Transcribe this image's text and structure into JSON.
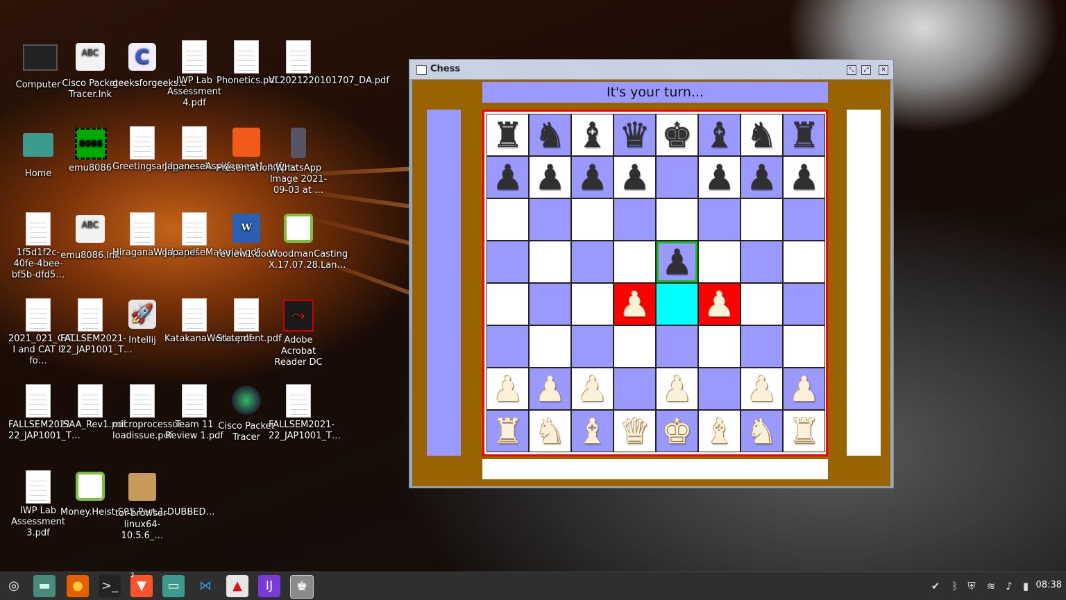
{
  "desktop_icons": [
    {
      "label": "Computer",
      "icon": "monitor-icon"
    },
    {
      "label": "Cisco Packet Tracer.lnk",
      "icon": "text-file-icon"
    },
    {
      "label": "geeksforgeeks.c",
      "icon": "c-source-icon"
    },
    {
      "label": "IWP Lab Assessment 4.pdf",
      "icon": "pdf-icon"
    },
    {
      "label": "Phonetics.pdf",
      "icon": "pdf-icon"
    },
    {
      "label": "VL2021220101707_DA.pdf",
      "icon": "pdf-icon"
    },
    {
      "label": "Home",
      "icon": "home-folder-icon"
    },
    {
      "label": "emu8086",
      "icon": "chip-icon"
    },
    {
      "label": "Greetingsandgenerals.pdf",
      "icon": "pdf-icon"
    },
    {
      "label": "JapaneseAssignment1.pdf",
      "icon": "pdf-icon"
    },
    {
      "label": "Presentation.pptx",
      "icon": "presentation-icon"
    },
    {
      "label": "WhatsApp Image 2021-09-03 at …",
      "icon": "image-icon"
    },
    {
      "label": "1f5d1f2c-40fe-4bee-bf5b-dfd5…",
      "icon": "pdf-icon"
    },
    {
      "label": "emu8086.lnk",
      "icon": "text-file-icon"
    },
    {
      "label": "HiraganaWorks.pdf",
      "icon": "pdf-icon"
    },
    {
      "label": "JapaneseMaterial.pdf",
      "icon": "pdf-icon"
    },
    {
      "label": "review1.docx",
      "icon": "word-doc-icon"
    },
    {
      "label": "WoodmanCasting X.17.07.28.Lan…",
      "icon": "video-icon"
    },
    {
      "label": "2021_021_CAT I and CAT II fo…",
      "icon": "pdf-icon"
    },
    {
      "label": "FALLSEM2021-22_JAP1001_T…",
      "icon": "pdf-icon"
    },
    {
      "label": "Intellij",
      "icon": "rocket-icon"
    },
    {
      "label": "KatakanaWorks.pdf",
      "icon": "pdf-icon"
    },
    {
      "label": "Statement.pdf",
      "icon": "pdf-icon"
    },
    {
      "label": "Adobe Acrobat Reader DC",
      "icon": "acrobat-icon"
    },
    {
      "label": "FALLSEM2021-22_JAP1001_T…",
      "icon": "pdf-icon"
    },
    {
      "label": "ISAA_Rev1.pdf",
      "icon": "pdf-icon"
    },
    {
      "label": "microprocessor loadissue.pdf",
      "icon": "pdf-icon"
    },
    {
      "label": "Team 11 Review 1.pdf",
      "icon": "pdf-icon"
    },
    {
      "label": "Cisco Packet Tracer",
      "icon": "cisco-icon"
    },
    {
      "label": "FALLSEM2021-22_JAP1001_T…",
      "icon": "pdf-icon"
    },
    {
      "label": "IWP Lab Assessment 3.pdf",
      "icon": "pdf-icon"
    },
    {
      "label": "Money.Heist.S05.Part.1.DUBBED…",
      "icon": "video-icon"
    },
    {
      "label": "tor-browser-linux64-10.5.6_…",
      "icon": "archive-icon"
    }
  ],
  "window": {
    "title": "Chess",
    "controls": [
      "minimize",
      "maximize",
      "close"
    ]
  },
  "game": {
    "status": "It's your turn...",
    "board": [
      [
        "br",
        "bn",
        "bb",
        "bq",
        "bk",
        "bb",
        "bn",
        "br"
      ],
      [
        "bp",
        "bp",
        "bp",
        "bp",
        "",
        "bp",
        "bp",
        "bp"
      ],
      [
        "",
        "",
        "",
        "",
        "",
        "",
        "",
        ""
      ],
      [
        "",
        "",
        "",
        "",
        "bp",
        "",
        "",
        ""
      ],
      [
        "",
        "",
        "",
        "wp",
        "",
        "wp",
        "",
        ""
      ],
      [
        "",
        "",
        "",
        "",
        "",
        "",
        "",
        ""
      ],
      [
        "wp",
        "wp",
        "wp",
        "",
        "wp",
        "",
        "wp",
        "wp"
      ],
      [
        "wr",
        "wn",
        "wb",
        "wq",
        "wk",
        "wb",
        "wn",
        "wr"
      ]
    ],
    "highlights": {
      "red": [
        [
          4,
          3
        ],
        [
          4,
          5
        ]
      ],
      "cyan": [
        [
          4,
          4
        ]
      ],
      "green": [
        [
          3,
          4
        ]
      ]
    },
    "colors": {
      "light": "#ffffff",
      "dark": "#9999ff",
      "frame": "#996400",
      "border": "#ff0000"
    }
  },
  "taskbar": {
    "apps": [
      {
        "icon": "mint-menu-icon"
      },
      {
        "icon": "show-desktop-icon"
      },
      {
        "icon": "firefox-icon"
      },
      {
        "icon": "terminal-icon"
      },
      {
        "icon": "brave-icon",
        "badge": "2"
      },
      {
        "icon": "files-icon"
      },
      {
        "icon": "vscode-icon"
      },
      {
        "icon": "intellij-rocket-icon"
      },
      {
        "icon": "intellij-idea-icon"
      },
      {
        "icon": "java-chess-icon"
      }
    ],
    "tray": [
      "tasks-icon",
      "bluetooth-icon",
      "shield-icon",
      "wifi-icon",
      "volume-icon",
      "battery-icon"
    ],
    "clock": "08:38"
  }
}
